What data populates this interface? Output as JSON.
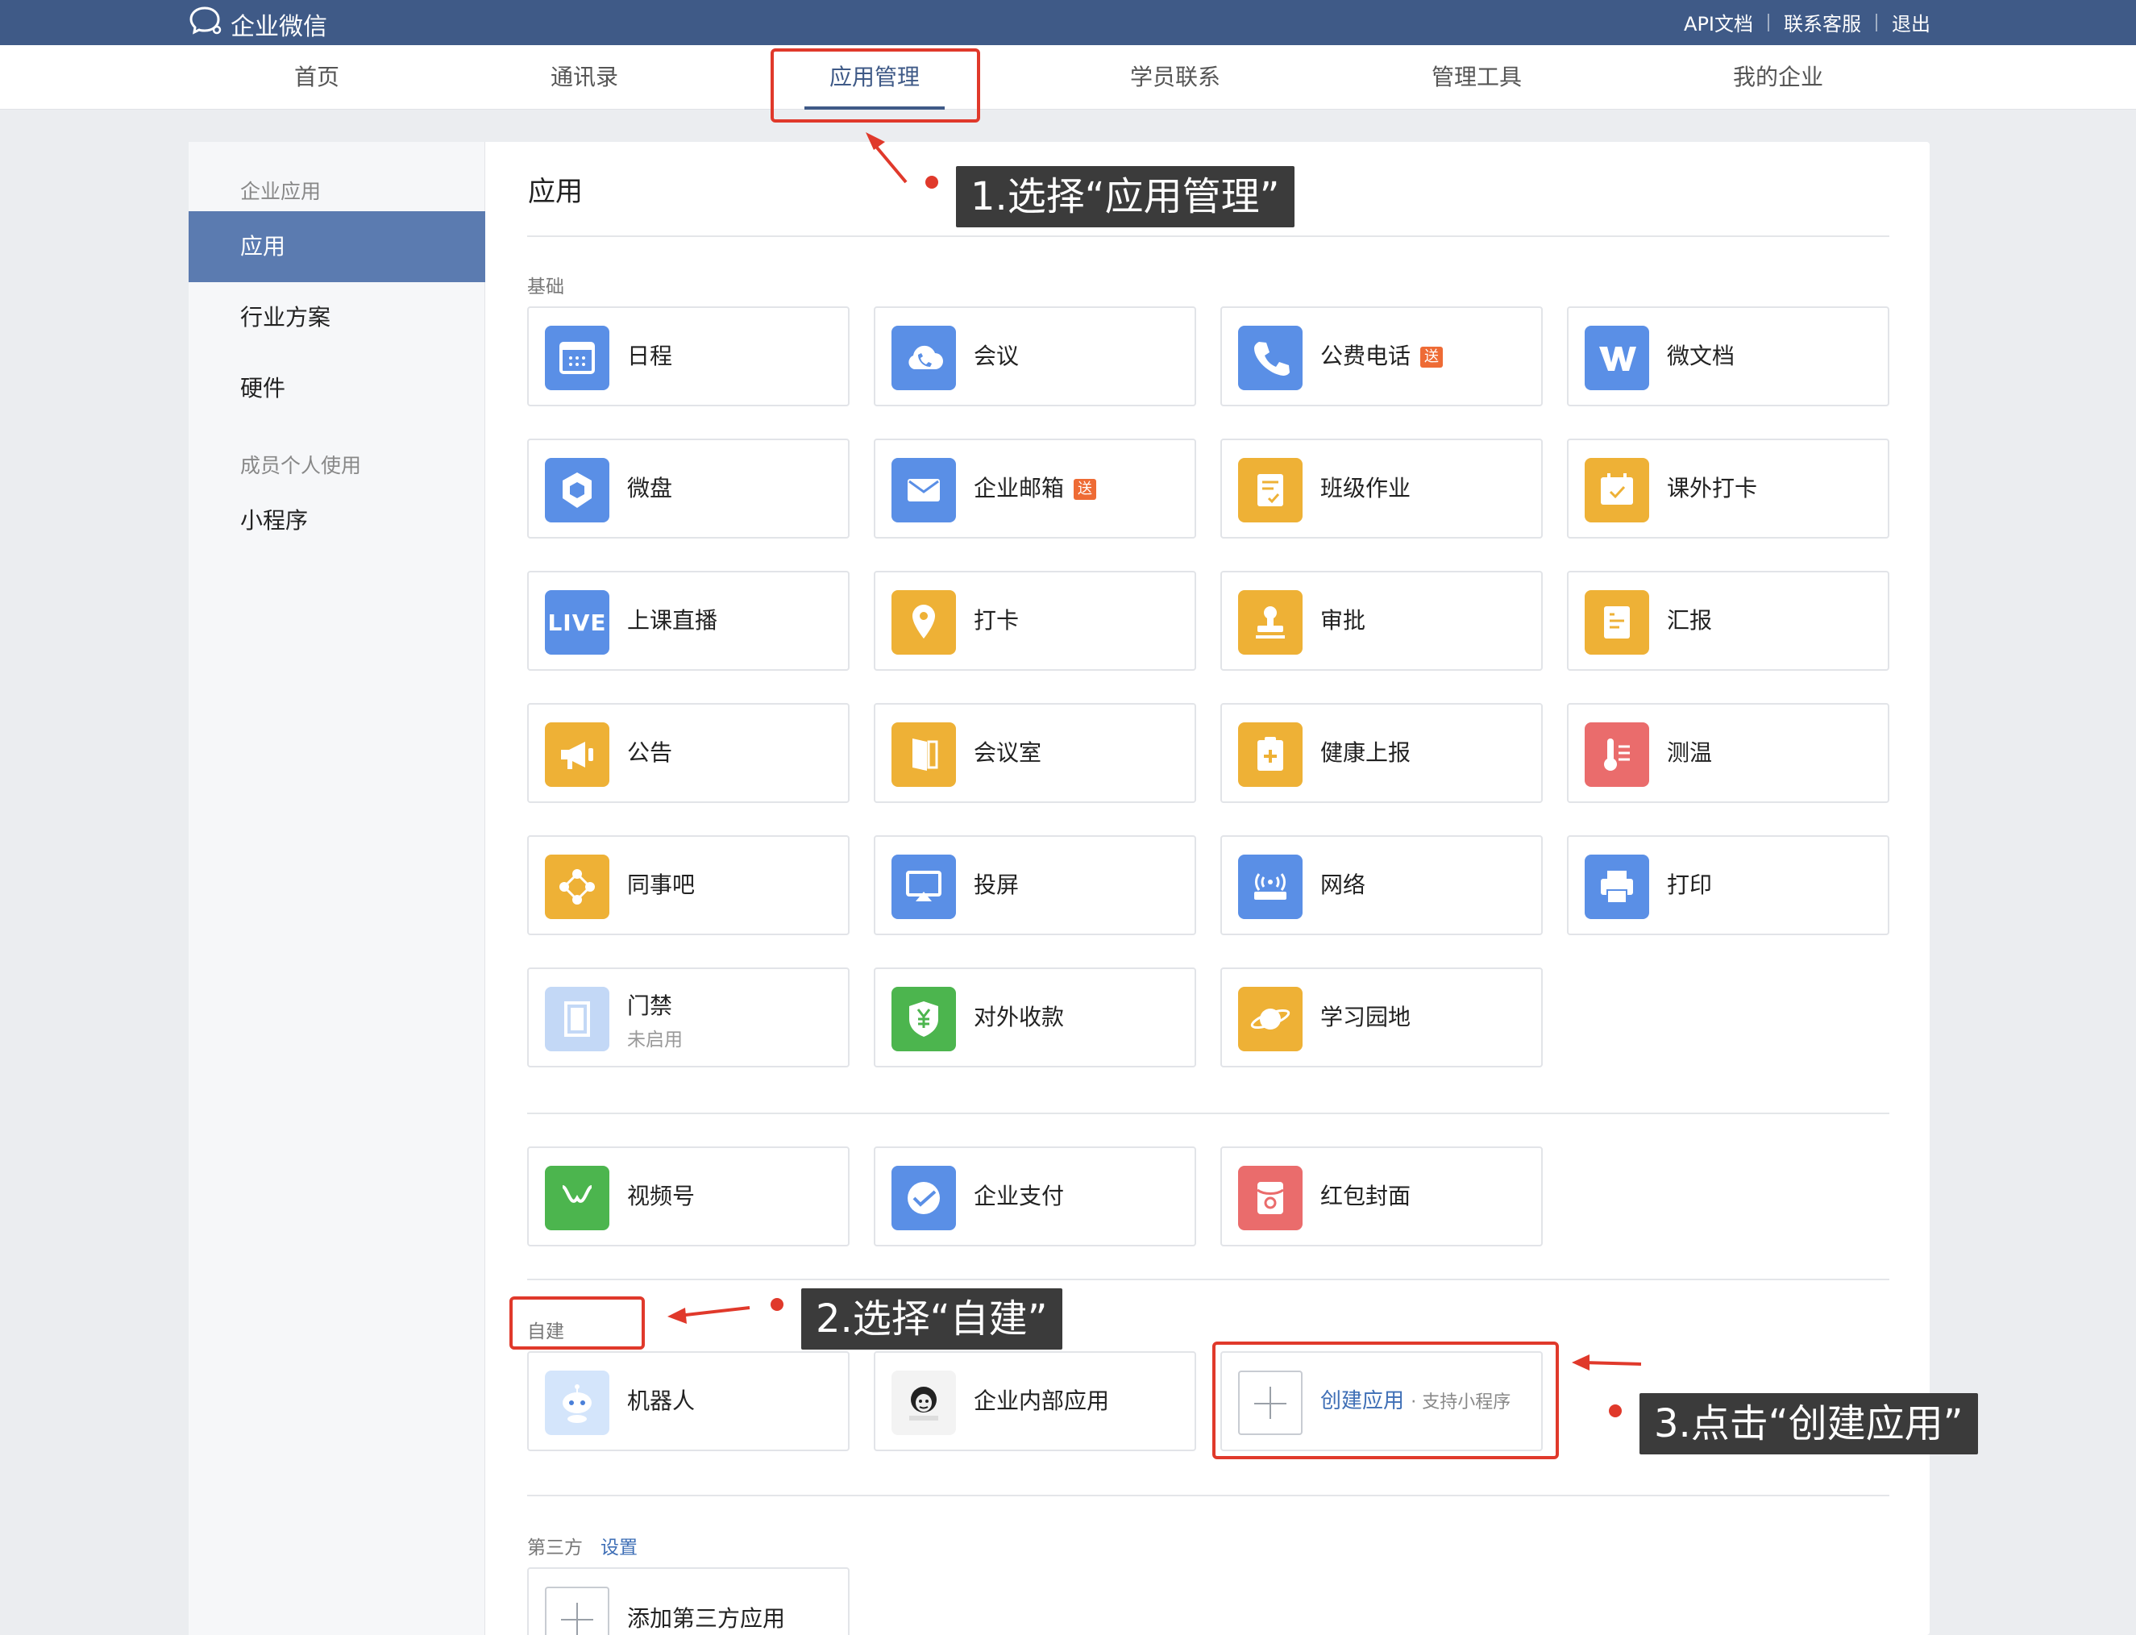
{
  "app": {
    "logo_text": "企业微信"
  },
  "top_links": [
    "API文档",
    "联系客服",
    "退出"
  ],
  "nav": {
    "items": [
      "首页",
      "通讯录",
      "应用管理",
      "学员联系",
      "管理工具",
      "我的企业"
    ],
    "active": "应用管理"
  },
  "sidebar": {
    "cat1": "企业应用",
    "item_apps": "应用",
    "item_industry": "行业方案",
    "item_hardware": "硬件",
    "cat2": "成员个人使用",
    "item_miniprogram": "小程序"
  },
  "main": {
    "title": "应用",
    "basic_label": "基础",
    "apps": [
      {
        "name": "日程"
      },
      {
        "name": "会议"
      },
      {
        "name": "公费电话",
        "badge": "送"
      },
      {
        "name": "微文档"
      },
      {
        "name": "微盘"
      },
      {
        "name": "企业邮箱",
        "badge": "送"
      },
      {
        "name": "班级作业"
      },
      {
        "name": "课外打卡"
      },
      {
        "name": "上课直播"
      },
      {
        "name": "打卡"
      },
      {
        "name": "审批"
      },
      {
        "name": "汇报"
      },
      {
        "name": "公告"
      },
      {
        "name": "会议室"
      },
      {
        "name": "健康上报"
      },
      {
        "name": "测温"
      },
      {
        "name": "同事吧"
      },
      {
        "name": "投屏"
      },
      {
        "name": "网络"
      },
      {
        "name": "打印"
      },
      {
        "name": "门禁",
        "sub": "未启用"
      },
      {
        "name": "对外收款"
      },
      {
        "name": "学习园地"
      }
    ],
    "wechat_apps": [
      {
        "name": "视频号"
      },
      {
        "name": "企业支付"
      },
      {
        "name": "红包封面"
      }
    ],
    "custom_label": "自建",
    "custom_apps": [
      {
        "name": "机器人"
      },
      {
        "name": "企业内部应用"
      }
    ],
    "create": {
      "label": "创建应用",
      "hint": "· 支持小程序"
    },
    "third_party_label": "第三方",
    "third_party_settings": "设置",
    "add_third_party": "添加第三方应用"
  },
  "annotations": {
    "step1": "1.选择“应用管理”",
    "step2": "2.选择“自建”",
    "step3": "3.点击“创建应用”"
  },
  "colors": {
    "header": "#3f5a87",
    "sidebar_active": "#5b7bb0",
    "annotation_red": "#e0392b"
  }
}
